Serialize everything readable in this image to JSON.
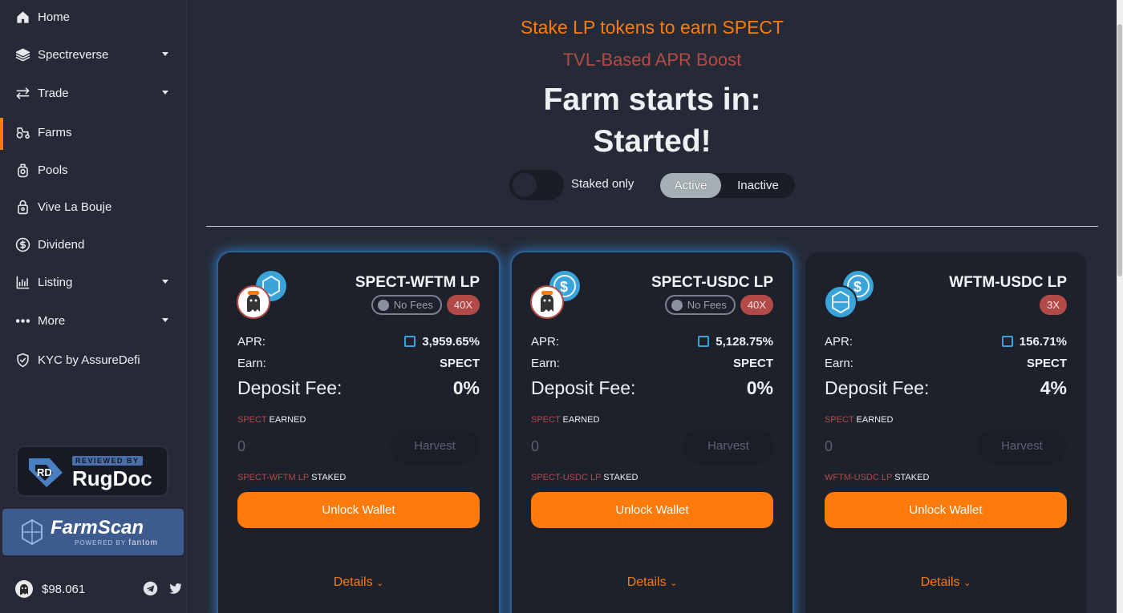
{
  "sidebar": {
    "items": [
      {
        "label": "Home",
        "icon": "home-icon"
      },
      {
        "label": "Spectreverse",
        "icon": "layers-icon"
      },
      {
        "label": "Trade",
        "icon": "swap-icon"
      },
      {
        "label": "Farms",
        "icon": "tractor-icon"
      },
      {
        "label": "Pools",
        "icon": "pool-icon"
      },
      {
        "label": "Vive La Bouje",
        "icon": "vault-icon"
      },
      {
        "label": "Dividend",
        "icon": "dividend-icon"
      },
      {
        "label": "Listing",
        "icon": "chart-icon"
      },
      {
        "label": "More",
        "icon": "more-icon"
      },
      {
        "label": "KYC by AssureDefi",
        "icon": "shield-icon"
      }
    ],
    "active": "Farms",
    "rugdoc": {
      "small": "REVIEWED BY",
      "big": "RugDoc"
    },
    "farmscan": {
      "big": "FarmScan",
      "small": "POWERED BY",
      "brand": "fantom"
    },
    "price": "$98.061"
  },
  "header": {
    "stake_text": "Stake LP tokens to earn SPECT",
    "tvl_text": "TVL-Based APR Boost",
    "farm_starts": "Farm starts in:",
    "started": "Started!"
  },
  "filters": {
    "staked_only": "Staked only",
    "active": "Active",
    "inactive": "Inactive"
  },
  "cards": [
    {
      "pair": "SPECT-WFTM LP",
      "no_fees": "No Fees",
      "multiplier": "40X",
      "apr_label": "APR:",
      "apr": "3,959.65%",
      "earn_label": "Earn:",
      "earn": "SPECT",
      "fee_label": "Deposit Fee:",
      "fee": "0%",
      "earned_token": "SPECT",
      "earned_suffix": "EARNED",
      "earned_value": "0",
      "harvest": "Harvest",
      "staked_token": "SPECT-WFTM LP",
      "staked_suffix": "STAKED",
      "unlock": "Unlock Wallet",
      "details": "Details"
    },
    {
      "pair": "SPECT-USDC LP",
      "no_fees": "No Fees",
      "multiplier": "40X",
      "apr_label": "APR:",
      "apr": "5,128.75%",
      "earn_label": "Earn:",
      "earn": "SPECT",
      "fee_label": "Deposit Fee:",
      "fee": "0%",
      "earned_token": "SPECT",
      "earned_suffix": "EARNED",
      "earned_value": "0",
      "harvest": "Harvest",
      "staked_token": "SPECT-USDC LP",
      "staked_suffix": "STAKED",
      "unlock": "Unlock Wallet",
      "details": "Details"
    },
    {
      "pair": "WFTM-USDC LP",
      "multiplier": "3X",
      "apr_label": "APR:",
      "apr": "156.71%",
      "earn_label": "Earn:",
      "earn": "SPECT",
      "fee_label": "Deposit Fee:",
      "fee": "4%",
      "earned_token": "SPECT",
      "earned_suffix": "EARNED",
      "earned_value": "0",
      "harvest": "Harvest",
      "staked_token": "WFTM-USDC LP",
      "staked_suffix": "STAKED",
      "unlock": "Unlock Wallet",
      "details": "Details"
    }
  ],
  "colors": {
    "background": "#262a36",
    "card": "#1d212c",
    "accent": "#fd7b0c",
    "multiplier": "#b24b48",
    "fantom_blue": "#3aa3d9"
  }
}
